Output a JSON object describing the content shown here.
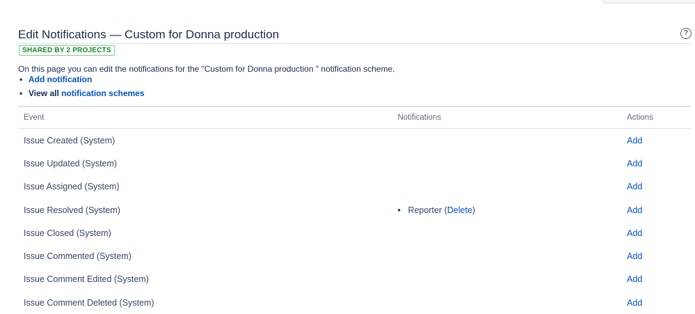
{
  "page": {
    "title": "Edit Notifications — Custom for Donna production",
    "badge": "SHARED BY 2 PROJECTS",
    "intro": "On this page you can edit the notifications for the \"Custom for Donna production \" notification scheme.",
    "links": {
      "add_notification": "Add notification",
      "view_all_prefix": "View all",
      "notification_schemes": "notification schemes"
    }
  },
  "table": {
    "headers": {
      "event": "Event",
      "notifications": "Notifications",
      "actions": "Actions"
    },
    "rows": [
      {
        "event": "Issue Created (System)",
        "notification": "",
        "delete": "",
        "action": "Add"
      },
      {
        "event": "Issue Updated (System)",
        "notification": "",
        "delete": "",
        "action": "Add"
      },
      {
        "event": "Issue Assigned (System)",
        "notification": "",
        "delete": "",
        "action": "Add"
      },
      {
        "event": "Issue Resolved (System)",
        "notification": "Reporter",
        "delete": "Delete",
        "action": "Add"
      },
      {
        "event": "Issue Closed (System)",
        "notification": "",
        "delete": "",
        "action": "Add"
      },
      {
        "event": "Issue Commented (System)",
        "notification": "",
        "delete": "",
        "action": "Add"
      },
      {
        "event": "Issue Comment Edited (System)",
        "notification": "",
        "delete": "",
        "action": "Add"
      },
      {
        "event": "Issue Comment Deleted (System)",
        "notification": "",
        "delete": "",
        "action": "Add"
      }
    ]
  },
  "colors": {
    "link": "#0052cc",
    "badge_text": "#14892c",
    "badge_border": "#79d28b",
    "rule": "#dfe1e6"
  },
  "icons": {
    "help": "question-circle-icon"
  }
}
